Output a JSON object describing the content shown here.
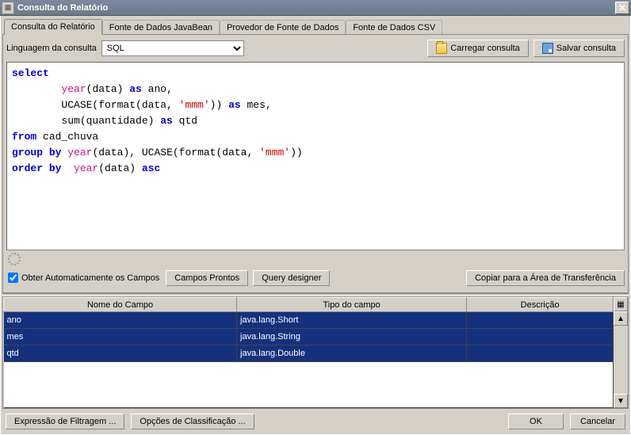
{
  "window": {
    "title": "Consulta do Relatório"
  },
  "tabs": [
    {
      "label": "Consulta do Relatório",
      "active": true
    },
    {
      "label": "Fonte de Dados JavaBean",
      "active": false
    },
    {
      "label": "Provedor de Fonte de Dados",
      "active": false
    },
    {
      "label": "Fonte de Dados CSV",
      "active": false
    }
  ],
  "query": {
    "language_label": "Linguagem da consulta",
    "language_value": "SQL",
    "load_button": "Carregar consulta",
    "save_button": "Salvar consulta"
  },
  "sql": {
    "line1_select": "select",
    "line2_pre": "        ",
    "line2_func": "year",
    "line2_post": "(data) ",
    "line2_as": "as",
    "line2_alias": " ano,",
    "line3_pre": "        UCASE(format(data, ",
    "line3_str": "'mmm'",
    "line3_mid": ")) ",
    "line3_as": "as",
    "line3_alias": " mes,",
    "line4_pre": "        sum(quantidade) ",
    "line4_as": "as",
    "line4_alias": " qtd",
    "line5_from": "from",
    "line5_table": " cad_chuva",
    "line6_group": "group",
    "line6_by": " by",
    "line6_pre": " ",
    "line6_func": "year",
    "line6_mid": "(data), UCASE(format(data, ",
    "line6_str": "'mmm'",
    "line6_end": "))",
    "line7_order": "order",
    "line7_by": " by",
    "line7_pre": "  ",
    "line7_func": "year",
    "line7_mid": "(data) ",
    "line7_asc": "asc"
  },
  "actions": {
    "auto_fields_label": "Obter Automaticamente os Campos",
    "auto_fields_checked": true,
    "ready_fields": "Campos Prontos",
    "query_designer": "Query designer",
    "copy_clipboard": "Copiar para a Área de Transferência"
  },
  "fields_table": {
    "headers": [
      "Nome do Campo",
      "Tipo do campo",
      "Descrição"
    ],
    "rows": [
      {
        "name": "ano",
        "type": "java.lang.Short",
        "desc": ""
      },
      {
        "name": "mes",
        "type": "java.lang.String",
        "desc": ""
      },
      {
        "name": "qtd",
        "type": "java.lang.Double",
        "desc": ""
      }
    ]
  },
  "bottom": {
    "filter_expr": "Expressão de Filtragem ...",
    "sort_options": "Opções de Classificação ...",
    "ok": "OK",
    "cancel": "Cancelar"
  }
}
